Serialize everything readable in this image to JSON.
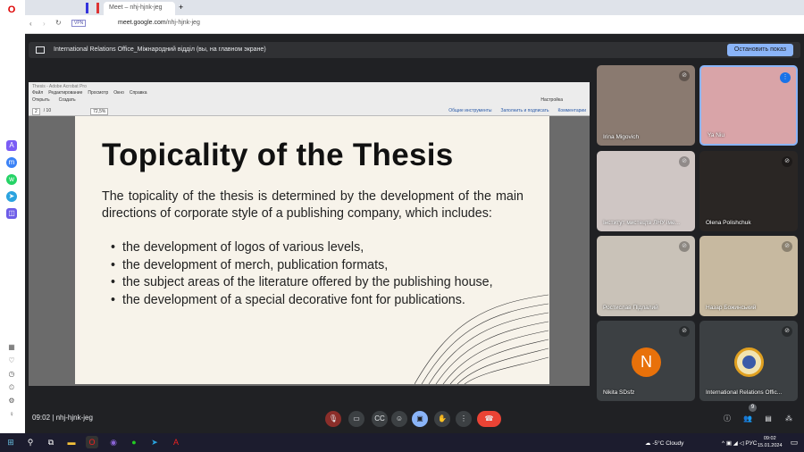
{
  "browser": {
    "tab_title": "Meet – nhj-hjnk-jeg",
    "url_host": "meet.google.com",
    "url_path": "/nhj-hjnk-jeg",
    "vpn": "VPN"
  },
  "meet": {
    "presenter_banner": "International Relations Office_Міжнародний відділ (вы, на главном экране)",
    "stop_button": "Остановить показ",
    "time": "09:02",
    "meeting_code": "nhj-hjnk-jeg",
    "people_count": "9"
  },
  "acrobat": {
    "title": "Thesis - Adobe Acrobat Pro",
    "menu": [
      "Файл",
      "Редактирование",
      "Просмотр",
      "Окно",
      "Справка"
    ],
    "open": "Открыть",
    "create": "Создать",
    "page": "2",
    "pages": "/ 10",
    "zoom": "72,5%",
    "customize": "Настройка",
    "tools": [
      "Общие инструменты",
      "Заполнить и подписать",
      "Комментарии"
    ]
  },
  "slide": {
    "title": "Topicality of the Thesis",
    "intro": "The topicality of the thesis is determined by the development of the main directions of corporate style of a publishing company, which includes:",
    "bullets": [
      "the development of logos of various levels,",
      "the development of merch, publication formats,",
      "the subject areas of the literature offered by the publishing house,",
      "the development of a special decorative font for publications."
    ]
  },
  "participants": [
    {
      "name": "Irina Migovich"
    },
    {
      "name": "Ya Niu"
    },
    {
      "name": "Інститут мистецтв ЛНУ іме..."
    },
    {
      "name": "Olena Polishchuk"
    },
    {
      "name": "Ростислав Підлалий"
    },
    {
      "name": "Назар Божинський"
    },
    {
      "name": "Nikita SDsfz",
      "initial": "N"
    },
    {
      "name": "International Relations Offic..."
    }
  ],
  "taskbar": {
    "weather": "-5°C  Cloudy",
    "lang": "РУС",
    "time": "09:02",
    "date": "15.01.2024"
  },
  "colors": {
    "accent": "#8ab4f8",
    "end_call": "#ea4335",
    "avatar": "#e8710a"
  }
}
